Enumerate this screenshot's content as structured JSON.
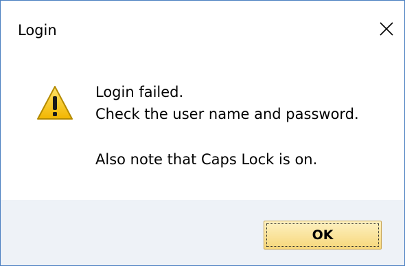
{
  "window": {
    "title": "Login",
    "close_icon": "close-icon"
  },
  "dialog": {
    "icon": "warning-icon",
    "message_lines": [
      "Login failed.",
      "Check the user name and password.",
      "Also note that Caps Lock is on."
    ]
  },
  "buttons": {
    "ok_label": "OK"
  },
  "colors": {
    "footer_bg": "#eef2f7",
    "button_top": "#fdf1c2",
    "button_bottom": "#f7d77a",
    "window_border": "#4a7fc1",
    "warning_yellow": "#f5c400"
  }
}
